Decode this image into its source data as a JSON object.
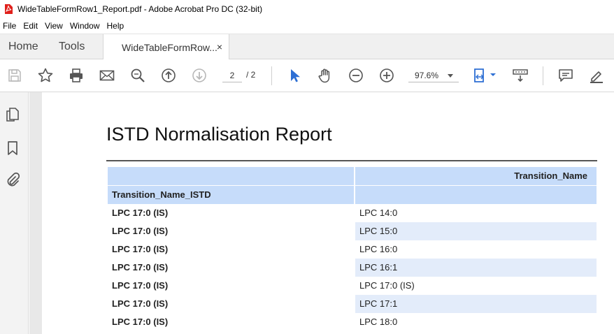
{
  "window": {
    "title": "WideTableFormRow1_Report.pdf - Adobe Acrobat Pro DC (32-bit)",
    "icon": "acrobat-pdf-icon"
  },
  "menu": [
    "File",
    "Edit",
    "View",
    "Window",
    "Help"
  ],
  "tabs": {
    "home": "Home",
    "tools": "Tools",
    "document": "WideTableFormRow...",
    "close": "×"
  },
  "toolbar": {
    "page_current": "2",
    "page_total": "/ 2",
    "zoom": "97.6%",
    "icons": [
      "save-icon",
      "bookmark-star-icon",
      "print-icon",
      "email-icon",
      "search-icon",
      "page-up-icon",
      "page-down-icon",
      "select-cursor-icon",
      "hand-tool-icon",
      "zoom-out-icon",
      "zoom-in-icon",
      "fit-page-icon",
      "scroll-mode-icon",
      "comment-icon",
      "highlight-pen-icon"
    ]
  },
  "sidebar": {
    "icons": [
      "page-thumbnails-icon",
      "bookmarks-icon",
      "attachments-icon"
    ]
  },
  "document": {
    "title": "ISTD Normalisation Report",
    "header_right": "Transition_Name",
    "header_left": "Transition_Name_ISTD",
    "rows": [
      {
        "istd": "LPC 17:0 (IS)",
        "name": "LPC 14:0"
      },
      {
        "istd": "LPC 17:0 (IS)",
        "name": "LPC 15:0"
      },
      {
        "istd": "LPC 17:0 (IS)",
        "name": "LPC 16:0"
      },
      {
        "istd": "LPC 17:0 (IS)",
        "name": "LPC 16:1"
      },
      {
        "istd": "LPC 17:0 (IS)",
        "name": "LPC 17:0 (IS)"
      },
      {
        "istd": "LPC 17:0 (IS)",
        "name": "LPC 17:1"
      },
      {
        "istd": "LPC 17:0 (IS)",
        "name": "LPC 18:0"
      }
    ]
  },
  "colors": {
    "header_blue": "#c6dcfa",
    "row_alt_blue": "#e3ecfa",
    "accent_blue": "#2d6fd4"
  }
}
